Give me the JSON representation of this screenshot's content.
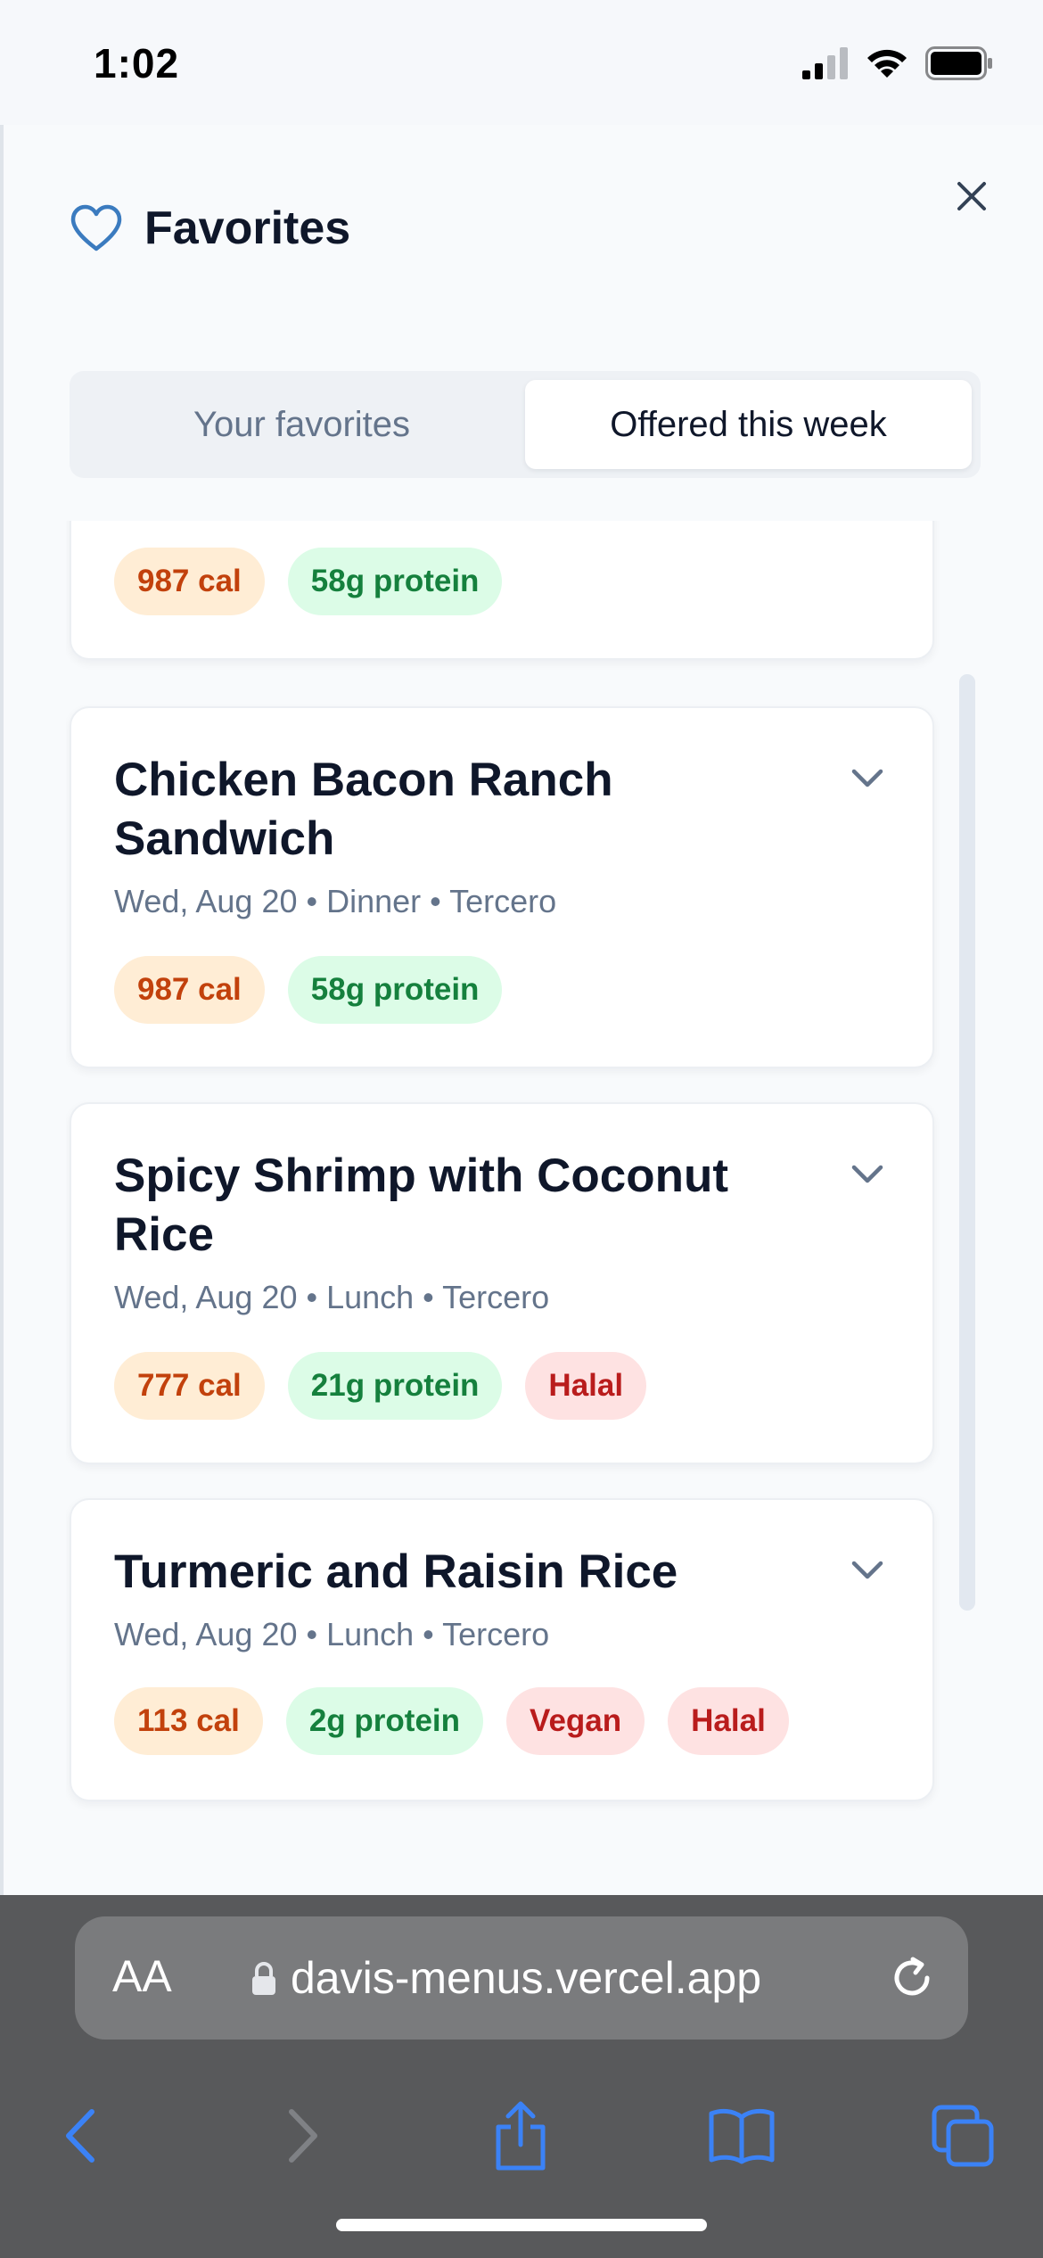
{
  "status_bar": {
    "time": "1:02"
  },
  "sheet": {
    "title": "Favorites",
    "tabs": [
      {
        "label": "Your favorites",
        "active": false
      },
      {
        "label": "Offered this week",
        "active": true
      }
    ]
  },
  "items": [
    {
      "title": "",
      "meta": "",
      "badges": [
        "987 cal",
        "58g protein"
      ]
    },
    {
      "title": "Chicken Bacon Ranch Sandwich",
      "meta": "Wed, Aug 20 • Dinner • Tercero",
      "badges": [
        "987 cal",
        "58g protein"
      ]
    },
    {
      "title": "Spicy Shrimp with Coconut Rice",
      "meta": "Wed, Aug 20 • Lunch • Tercero",
      "badges": [
        "777 cal",
        "21g protein",
        "Halal"
      ]
    },
    {
      "title": "Turmeric and Raisin Rice",
      "meta": "Wed, Aug 20 • Lunch • Tercero",
      "badges": [
        "113 cal",
        "2g protein",
        "Vegan",
        "Halal"
      ]
    }
  ],
  "browser": {
    "text_size_label": "AA",
    "url": "davis-menus.vercel.app"
  },
  "colors": {
    "accent": "#3b7bbf",
    "cal_bg": "#ffedd5",
    "protein_bg": "#dcfce7",
    "diet_bg": "#fee2e2"
  }
}
